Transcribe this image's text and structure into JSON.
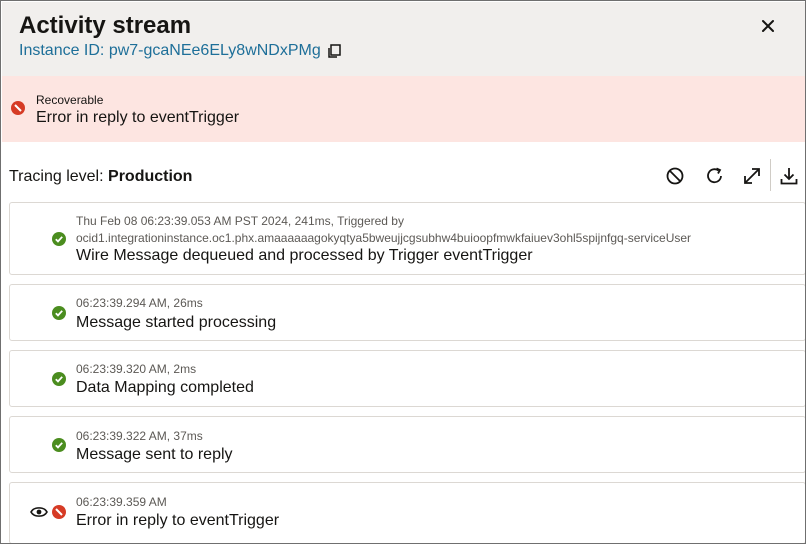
{
  "header": {
    "title": "Activity stream",
    "instance_id": "Instance ID: pw7-gcaNEe6ELy8wNDxPMg"
  },
  "banner": {
    "label": "Recoverable",
    "message": "Error in reply to eventTrigger"
  },
  "tracing": {
    "label": "Tracing level:",
    "value": "Production"
  },
  "toolbar": {
    "icons": [
      "clear-icon",
      "refresh-icon",
      "expand-icon",
      "download-icon"
    ]
  },
  "events": [
    {
      "meta_line1": "Thu Feb 08 06:23:39.053 AM PST 2024, 241ms, Triggered by",
      "meta_line2": "ocid1.integrationinstance.oc1.phx.amaaaaaagokyqtya5bweujjcgsubhw4buioopfmwkfaiuev3ohl5spijnfgq-serviceUser",
      "message": "Wire Message dequeued and processed by Trigger eventTrigger",
      "status": "success"
    },
    {
      "meta_line1": "06:23:39.294 AM, 26ms",
      "message": "Message started processing",
      "status": "success"
    },
    {
      "meta_line1": "06:23:39.320 AM, 2ms",
      "message": "Data Mapping completed",
      "status": "success"
    },
    {
      "meta_line1": "06:23:39.322 AM, 37ms",
      "message": "Message sent to reply",
      "status": "success"
    },
    {
      "meta_line1": "06:23:39.359 AM",
      "message": "Error in reply to eventTrigger",
      "status": "error"
    }
  ],
  "colors": {
    "success": "#4b8d1f",
    "error": "#d63b25",
    "link": "#1e6f99",
    "banner_bg": "#fde5e1",
    "header_bg": "#f1efed"
  }
}
